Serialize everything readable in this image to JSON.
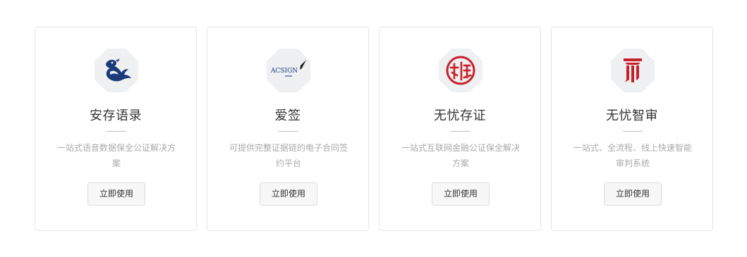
{
  "products": [
    {
      "title": "安存语录",
      "description": "一站式语音数据保全公证解决方案",
      "button_label": "立即使用",
      "icon": "bird-logo-icon",
      "icon_color": "#1b3a7a"
    },
    {
      "title": "爱签",
      "description": "可提供完整证据链的电子合同签约平台",
      "button_label": "立即使用",
      "icon": "acsign-logo-icon",
      "icon_text": "ACSIGN",
      "icon_color": "#1b3a7a"
    },
    {
      "title": "无忧存证",
      "description": "一站式互联网金融公证保全解决方案",
      "button_label": "立即使用",
      "icon": "seal-logo-icon",
      "icon_color": "#c8202a"
    },
    {
      "title": "无忧智审",
      "description": "一站式、全流程、线上快速智能审判系统",
      "button_label": "立即使用",
      "icon": "pillar-logo-icon",
      "icon_color": "#c8202a"
    }
  ],
  "colors": {
    "logo_background": "#eef0f2",
    "card_border": "#e6e6e6",
    "title_text": "#333333",
    "description_text": "#aaaaaa",
    "button_background": "#f7f7f7"
  }
}
